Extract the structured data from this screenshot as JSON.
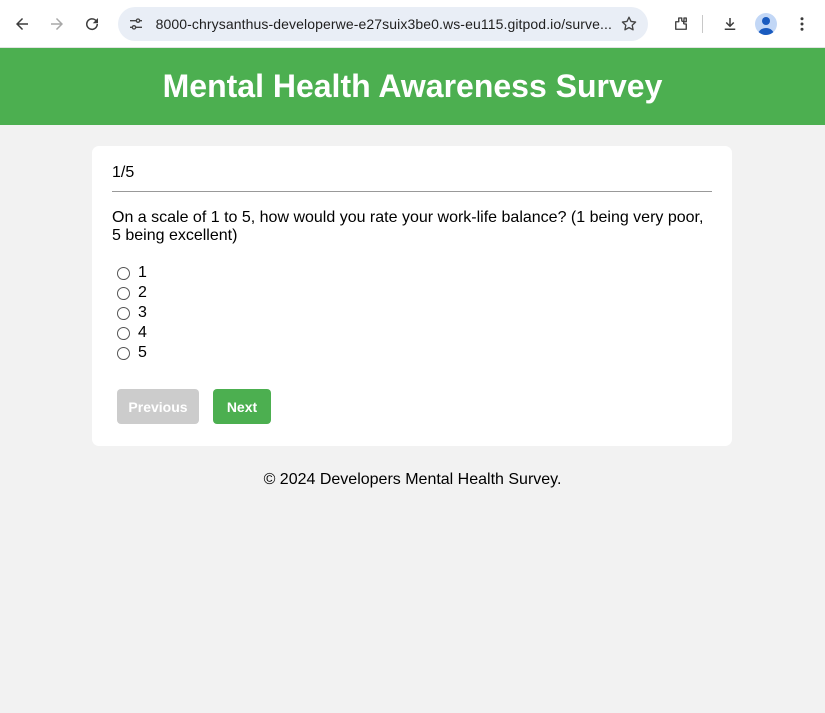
{
  "browser": {
    "url": "8000-chrysanthus-developerwe-e27suix3be0.ws-eu115.gitpod.io/surve..."
  },
  "header": {
    "title": "Mental Health Awareness Survey"
  },
  "survey": {
    "progress": "1/5",
    "question": "On a scale of 1 to 5, how would you rate your work-life balance? (1 being very poor, 5 being excellent)",
    "options": [
      "1",
      "2",
      "3",
      "4",
      "5"
    ],
    "previous_label": "Previous",
    "next_label": "Next"
  },
  "footer": {
    "text": "© 2024 Developers Mental Health Survey."
  },
  "colors": {
    "brand_green": "#4caf50",
    "disabled_gray": "#cccccc",
    "page_background": "#f2f2f2"
  }
}
